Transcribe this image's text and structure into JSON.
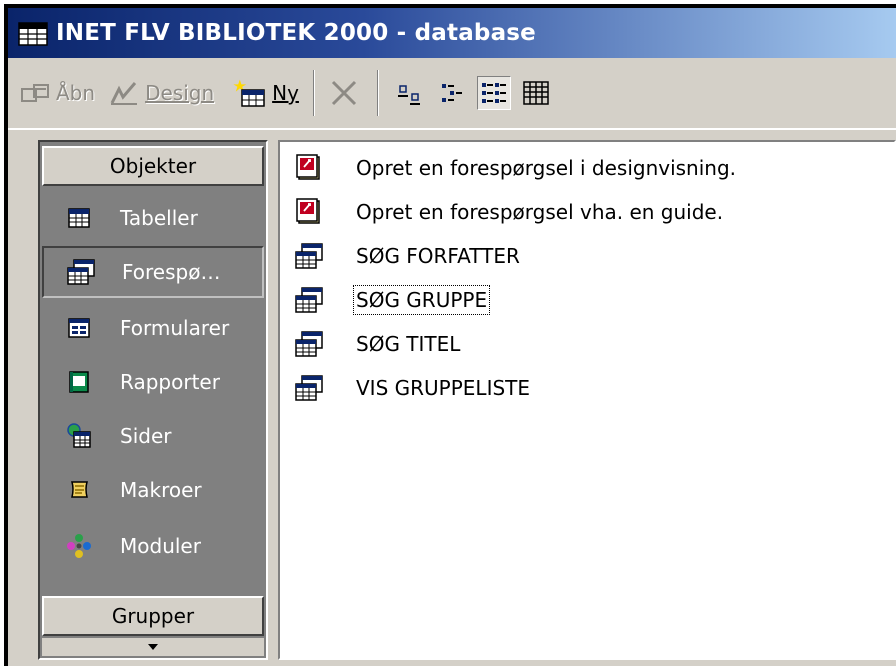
{
  "window": {
    "title": "INET FLV BIBLIOTEK 2000 - database",
    "title_gradient": [
      "#0a246a",
      "#a6caf0"
    ]
  },
  "toolbar": {
    "open_label": "Åbn",
    "design_label": "Design",
    "new_label": "Ny",
    "view_buttons": [
      "large-icons",
      "small-icons",
      "list",
      "details"
    ],
    "pressed_view": "list"
  },
  "objects_bar": {
    "header": "Objekter",
    "footer": "Grupper",
    "items": [
      {
        "label": "Tabeller",
        "icon": "table-icon"
      },
      {
        "label": "Forespø…",
        "icon": "query-icon",
        "selected": true
      },
      {
        "label": "Formularer",
        "icon": "form-icon"
      },
      {
        "label": "Rapporter",
        "icon": "report-icon"
      },
      {
        "label": "Sider",
        "icon": "page-icon"
      },
      {
        "label": "Makroer",
        "icon": "macro-icon"
      },
      {
        "label": "Moduler",
        "icon": "module-icon"
      }
    ]
  },
  "list": {
    "items": [
      {
        "label": "Opret en forespørgsel i designvisning.",
        "icon": "create-wizard-icon"
      },
      {
        "label": "Opret en forespørgsel vha. en guide.",
        "icon": "create-wizard-icon"
      },
      {
        "label": "SØG FORFATTER",
        "icon": "query-icon"
      },
      {
        "label": "SØG GRUPPE",
        "icon": "query-icon",
        "focused": true
      },
      {
        "label": "SØG TITEL",
        "icon": "query-icon"
      },
      {
        "label": "VIS GRUPPELISTE",
        "icon": "query-icon"
      }
    ]
  }
}
